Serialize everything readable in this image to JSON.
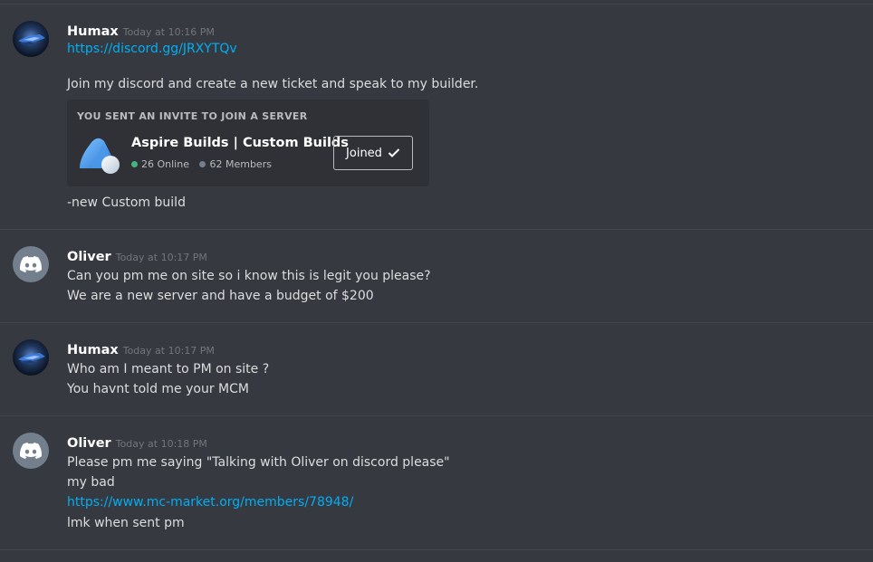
{
  "messages": [
    {
      "username": "Humax",
      "timestamp": "Today at 10:16 PM",
      "avatar_icon": "space-ship-avatar",
      "lines": [
        {
          "text": "https://discord.gg/JRXYTQv",
          "type": "link"
        },
        {
          "text": "Join my discord and create a new ticket and speak to my builder.",
          "type": "text"
        }
      ],
      "invite": {
        "heading": "YOU SENT AN INVITE TO JOIN A SERVER",
        "server_name": "Aspire Builds | Custom Builds",
        "online": "26 Online",
        "members": "62 Members",
        "button_label": "Joined",
        "online_color": "#43b581"
      },
      "after_invite": "-new Custom build"
    },
    {
      "username": "Oliver",
      "timestamp": "Today at 10:17 PM",
      "avatar_icon": "discord-logo-avatar",
      "lines": [
        {
          "text": "Can you pm me on site so i know this is legit you please?",
          "type": "text"
        },
        {
          "text": "We are a new server and have a budget of $200",
          "type": "text"
        }
      ]
    },
    {
      "username": "Humax",
      "timestamp": "Today at 10:17 PM",
      "avatar_icon": "space-ship-avatar",
      "lines": [
        {
          "text": "Who am I meant to PM on site ?",
          "type": "text"
        },
        {
          "text": "You havnt told me your MCM",
          "type": "text"
        }
      ]
    },
    {
      "username": "Oliver",
      "timestamp": "Today at 10:18 PM",
      "avatar_icon": "discord-logo-avatar",
      "lines": [
        {
          "text": "Please pm me saying \"Talking with Oliver on discord please\"",
          "type": "text"
        },
        {
          "text": "my bad",
          "type": "text"
        },
        {
          "text": "https://www.mc-market.org/members/78948/",
          "type": "link"
        },
        {
          "text": "lmk when sent pm",
          "type": "text"
        }
      ]
    }
  ],
  "colors": {
    "background": "#36393f",
    "link": "#00aff4",
    "username": "#ffffff",
    "text": "#dcddde"
  }
}
